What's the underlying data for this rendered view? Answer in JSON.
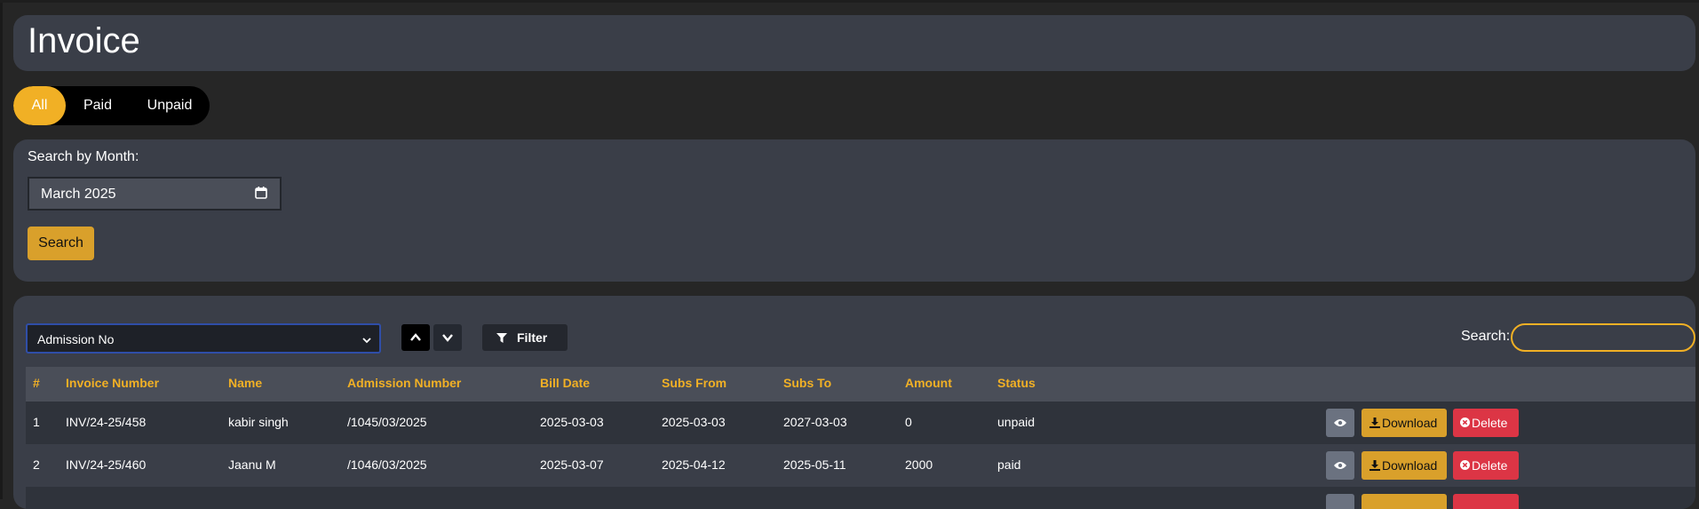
{
  "page": {
    "title": "Invoice"
  },
  "tabs": [
    {
      "label": "All",
      "active": true
    },
    {
      "label": "Paid",
      "active": false
    },
    {
      "label": "Unpaid",
      "active": false
    }
  ],
  "month_search": {
    "label": "Search by Month:",
    "value": "March 2025",
    "button": "Search"
  },
  "table_controls": {
    "sort_field": "Admission No",
    "filter_label": "Filter",
    "search_label": "Search:",
    "search_value": ""
  },
  "table": {
    "headers": [
      "#",
      "Invoice Number",
      "Name",
      "Admission Number",
      "Bill Date",
      "Subs From",
      "Subs To",
      "Amount",
      "Status"
    ],
    "rows": [
      {
        "num": "1",
        "invoice": "INV/24-25/458",
        "name": "kabir singh",
        "admission": "/1045/03/2025",
        "bill_date": "2025-03-03",
        "subs_from": "2025-03-03",
        "subs_to": "2027-03-03",
        "amount": "0",
        "status": "unpaid"
      },
      {
        "num": "2",
        "invoice": "INV/24-25/460",
        "name": "Jaanu M",
        "admission": "/1046/03/2025",
        "bill_date": "2025-03-07",
        "subs_from": "2025-04-12",
        "subs_to": "2025-05-11",
        "amount": "2000",
        "status": "paid"
      }
    ],
    "actions": {
      "download": "Download",
      "delete": "Delete"
    }
  },
  "colors": {
    "accent": "#f1b025",
    "download_button": "#d9a02b",
    "delete_button": "#dc3545",
    "view_button": "#6b7280",
    "card": "#3a3e48",
    "background": "#262626"
  }
}
